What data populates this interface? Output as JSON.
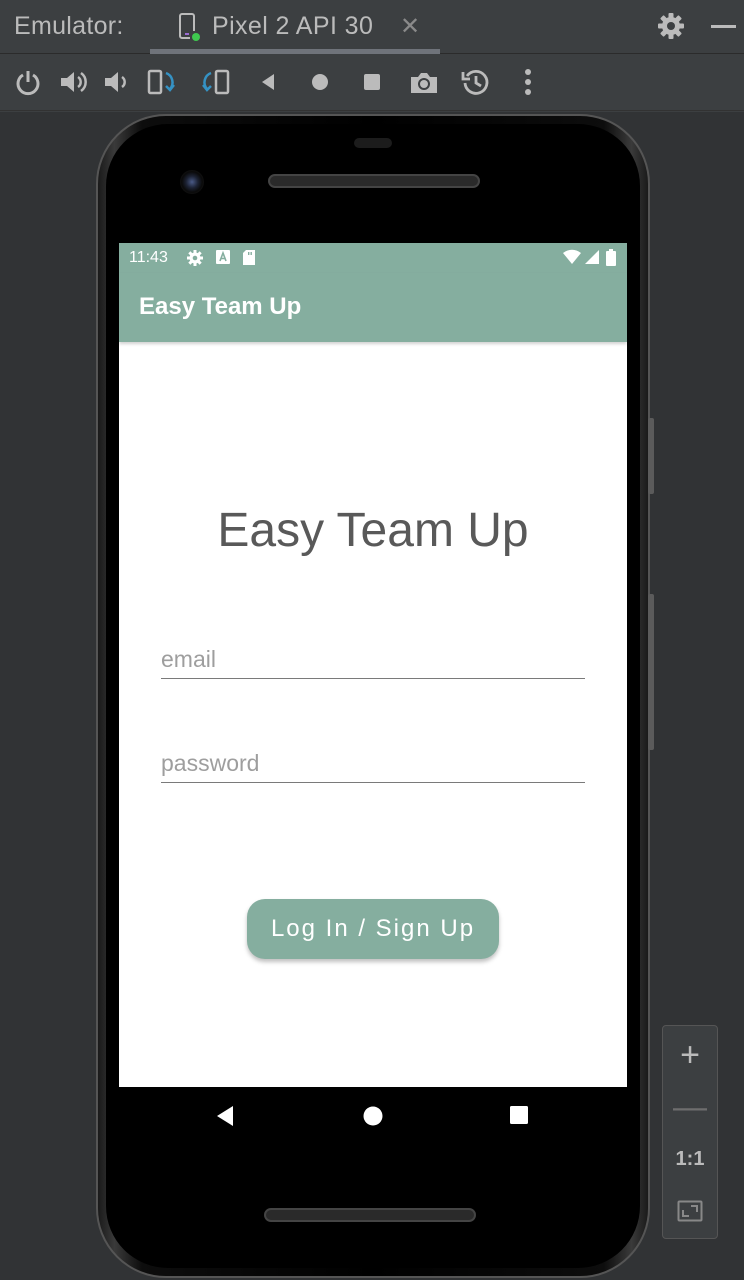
{
  "emulator": {
    "title": "Emulator:",
    "tab_label": "Pixel 2 API 30",
    "tab_close": "✕"
  },
  "toolbar": {
    "buttons": [
      "power",
      "volume-up",
      "volume-down",
      "rotate-left",
      "rotate-right",
      "back",
      "home",
      "overview",
      "screenshot",
      "snapshot",
      "more"
    ]
  },
  "status_bar": {
    "time": "11:43"
  },
  "app_bar": {
    "title": "Easy Team Up"
  },
  "main": {
    "title": "Easy Team Up",
    "email_placeholder": "email",
    "password_placeholder": "password",
    "login_label": "Log In / Sign Up"
  },
  "zoom": {
    "plus": "+",
    "minus": "—",
    "one_to_one": "1:1"
  },
  "colors": {
    "accent": "#85ae9f",
    "ide_background": "#3c3f41"
  }
}
